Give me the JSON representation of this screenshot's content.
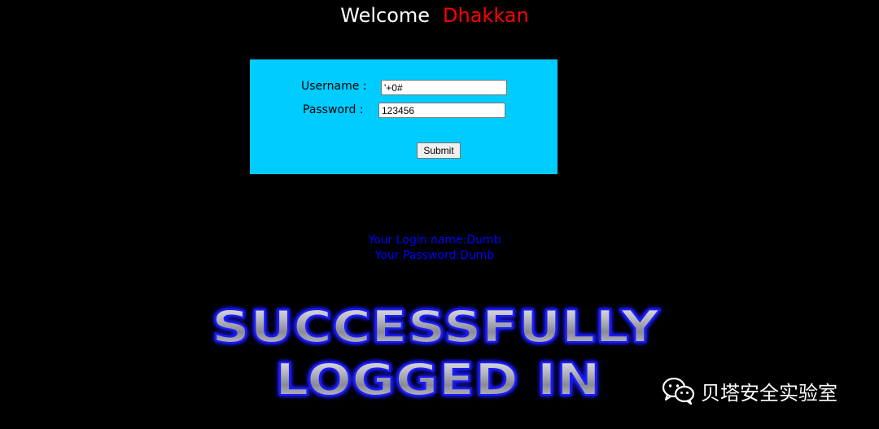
{
  "header": {
    "welcome_label": "Welcome",
    "name_label": "Dhakkan",
    "name_color": "#ff0000"
  },
  "form": {
    "background": "#00ccff",
    "username_label": "Username :",
    "password_label": "Password :",
    "username_value": "'+0#",
    "password_value": "123456",
    "submit_label": "Submit"
  },
  "result": {
    "login_line": "Your Login name:Dumb",
    "password_line": "Your Password:Dumb",
    "color": "#0000ff"
  },
  "banner": {
    "line1": "SUCCESSFULLY",
    "line2": "LOGGED IN",
    "glow_color": "#2020ff"
  },
  "watermark": {
    "icon": "wechat-icon",
    "text": "贝塔安全实验室"
  }
}
